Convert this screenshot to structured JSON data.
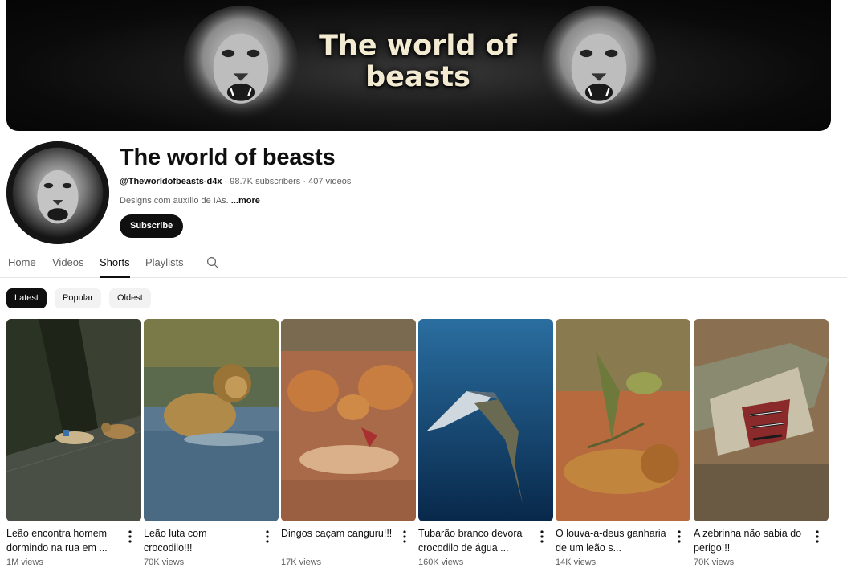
{
  "banner": {
    "title_line1": "The world of",
    "title_line2": "beasts"
  },
  "channel": {
    "name": "The world of beasts",
    "handle": "@Theworldofbeasts-d4x",
    "subscribers": "98.7K subscribers",
    "videos": "407 videos",
    "description": "Designs com auxílio de IAs.",
    "more_label": "...more",
    "subscribe_label": "Subscribe"
  },
  "tabs": [
    {
      "label": "Home",
      "active": false
    },
    {
      "label": "Videos",
      "active": false
    },
    {
      "label": "Shorts",
      "active": true
    },
    {
      "label": "Playlists",
      "active": false
    }
  ],
  "search_icon": "search-icon",
  "chips": [
    {
      "label": "Latest",
      "active": true
    },
    {
      "label": "Popular",
      "active": false
    },
    {
      "label": "Oldest",
      "active": false
    }
  ],
  "shorts": [
    {
      "title": "Leão encontra homem dormindo na rua em ...",
      "views": "1M views"
    },
    {
      "title": "Leão luta com crocodilo!!!",
      "views": "70K views"
    },
    {
      "title": "Dingos caçam canguru!!!",
      "views": "17K views"
    },
    {
      "title": "Tubarão branco devora crocodilo de água ...",
      "views": "160K views"
    },
    {
      "title": "O louva-a-deus ganharia de um leão s...",
      "views": "14K views"
    },
    {
      "title": "A zebrinha não sabia do perigo!!!",
      "views": "70K views"
    }
  ],
  "colors": {
    "primary_text": "#0f0f0f",
    "secondary_text": "#606060",
    "chip_bg": "#f2f2f2",
    "divider": "#e5e5e5"
  }
}
